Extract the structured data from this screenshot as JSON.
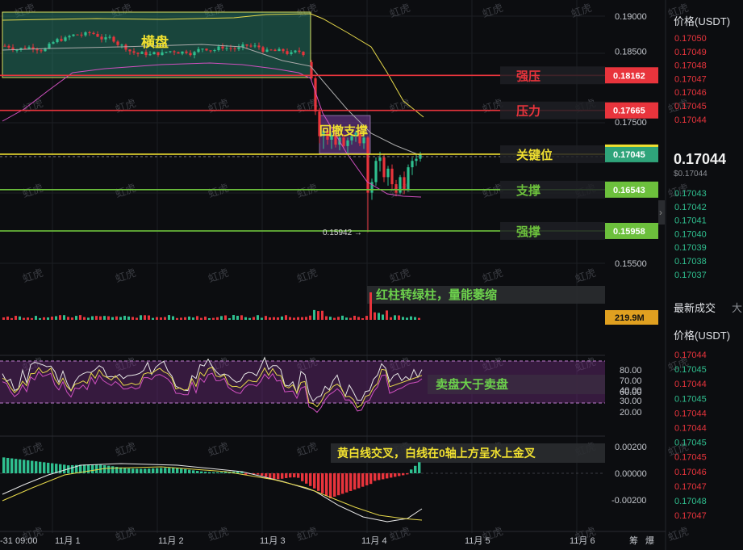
{
  "chart_data": {
    "type": "candlestick",
    "symbol_unit": "USDT",
    "price_axis": {
      "ticks": [
        "0.19000",
        "0.18500",
        "0.17500",
        "0.15500"
      ],
      "range": [
        0.153,
        0.1918
      ]
    },
    "x_axis_labels": [
      "-31 09:00",
      "11月 1",
      "11月 2",
      "11月 3",
      "11月 4",
      "11月 5",
      "11月 6"
    ],
    "levels": [
      {
        "name": "强压",
        "value": 0.18162,
        "price_label": "0.18162",
        "color": "#e8343c"
      },
      {
        "name": "压力",
        "value": 0.17665,
        "price_label": "0.17665",
        "color": "#e8343c"
      },
      {
        "name": "关键位",
        "value": 0.17045,
        "price_label": "0.17045",
        "color": "#f0e030"
      },
      {
        "name": "支撑",
        "value": 0.16543,
        "price_label": "0.16543",
        "color": "#6cc03c"
      },
      {
        "name": "强撑",
        "value": 0.15958,
        "price_label": "0.15958",
        "color": "#6cc03c"
      }
    ],
    "annotations": {
      "consolidation": "横盘",
      "pullback": "回撤支撑",
      "low_marker": "0.15942",
      "volume_note": "红柱转绿柱，量能萎缩",
      "kdj_note": "卖盘大于卖盘",
      "macd_note": "黄白线交叉，白线在0轴上方呈水上金叉"
    },
    "current_price": "0.17044",
    "volume_label": "219.9M",
    "rsi_axis": [
      "80.00",
      "70.00",
      "60.00",
      "40.00",
      "30.00",
      "20.00"
    ],
    "macd_axis": [
      "0.00200",
      "0.00000",
      "-0.00200"
    ]
  },
  "right_panel": {
    "header_top": "价格(USDT)",
    "asks": [
      "0.17050",
      "0.17049",
      "0.17048",
      "0.17047",
      "0.17046",
      "0.17045",
      "0.17044"
    ],
    "last_price": "0.17044",
    "last_price_sub": "$0.17044",
    "bids": [
      "0.17043",
      "0.17042",
      "0.17041",
      "0.17040",
      "0.17039",
      "0.17038",
      "0.17037"
    ],
    "trades_title": "最新成交",
    "trades_tab2": "大",
    "trades_header": "价格(USDT)",
    "trades": [
      {
        "p": "0.17044",
        "c": "red"
      },
      {
        "p": "0.17045",
        "c": "green"
      },
      {
        "p": "0.17044",
        "c": "red"
      },
      {
        "p": "0.17045",
        "c": "green"
      },
      {
        "p": "0.17044",
        "c": "red"
      },
      {
        "p": "0.17044",
        "c": "red"
      },
      {
        "p": "0.17045",
        "c": "green"
      },
      {
        "p": "0.17045",
        "c": "red"
      },
      {
        "p": "0.17046",
        "c": "red"
      },
      {
        "p": "0.17047",
        "c": "red"
      },
      {
        "p": "0.17048",
        "c": "green"
      },
      {
        "p": "0.17047",
        "c": "red"
      }
    ],
    "bottom_labels": [
      "筹",
      "爆"
    ],
    "watermark": "虹虎"
  },
  "colors": {
    "up": "#2fbf8f",
    "down": "#e8343c",
    "bg": "#0c0d10"
  }
}
